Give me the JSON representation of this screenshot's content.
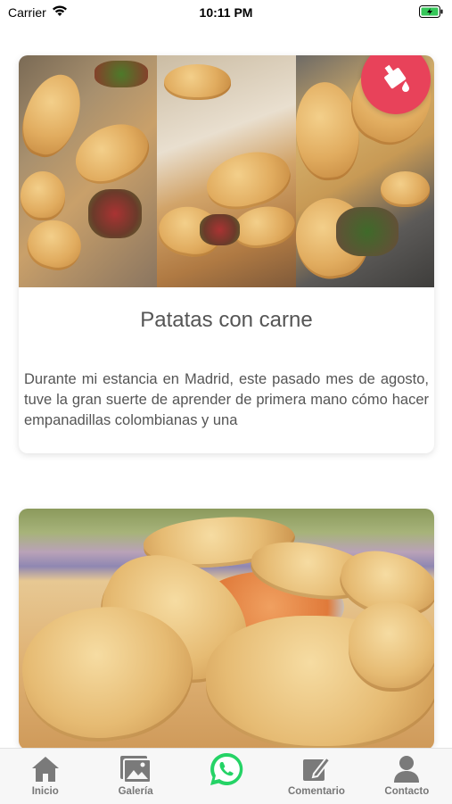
{
  "status": {
    "carrier": "Carrier",
    "time": "10:11 PM"
  },
  "cards": [
    {
      "title": "Patatas con carne",
      "text": "Durante mi estancia en Madrid, este pasado mes de agosto, tuve la gran suerte de aprender de primera mano cómo hacer empanadillas colombianas y una"
    }
  ],
  "tabs": [
    {
      "label": "Inicio",
      "icon": "home-icon"
    },
    {
      "label": "Galería",
      "icon": "gallery-icon"
    },
    {
      "label": "",
      "icon": "whatsapp-icon"
    },
    {
      "label": "Comentario",
      "icon": "comment-edit-icon"
    },
    {
      "label": "Contacto",
      "icon": "person-icon"
    }
  ],
  "colors": {
    "accent": "#e8425a",
    "whatsapp": "#25d366",
    "tab_icon": "#7a7a7a"
  }
}
